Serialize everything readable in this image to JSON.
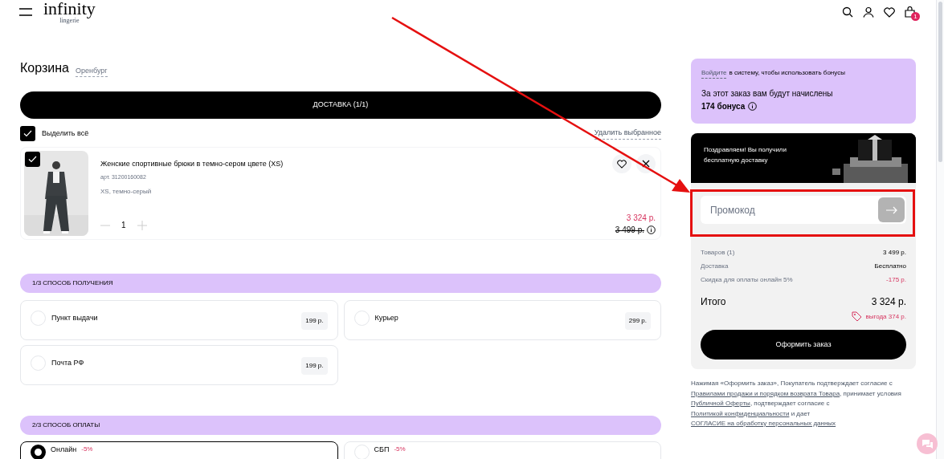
{
  "header": {
    "logo": "infinity",
    "logo_sub": "lingerie",
    "cart_count": "1"
  },
  "cart": {
    "title": "Корзина",
    "city": "Оренбург",
    "tab": "ДОСТАВКА (1/1)",
    "select_all": {
      "label": "Выделить всё",
      "checked": true
    },
    "delete_selected": "Удалить выбранное",
    "items": [
      {
        "checked": true,
        "name": "Женские спортивные брюки в темно-сером цвете (XS)",
        "sku": "арт. 31200160082",
        "variant": "XS, темно-серый",
        "qty": "1",
        "price": "3 324 р.",
        "old_price": "3 499 р."
      }
    ]
  },
  "delivery": {
    "title": "1/3 СПОСОБ ПОЛУЧЕНИЯ",
    "options": [
      {
        "label": "Пункт выдачи",
        "price": "199 р.",
        "selected": false
      },
      {
        "label": "Курьер",
        "price": "299 р.",
        "selected": false
      },
      {
        "label": "Почта РФ",
        "price": "199 р.",
        "selected": false
      }
    ]
  },
  "payment": {
    "title": "2/3 СПОСОБ ОПЛАТЫ",
    "options": [
      {
        "label": "Онлайн",
        "discount": "-5%",
        "selected": true
      },
      {
        "label": "СБП",
        "discount": "-5%",
        "selected": false
      }
    ]
  },
  "bonus": {
    "login_link": "Войдите",
    "login_rest": "в систему, чтобы использовать бонусы",
    "accrual": "За этот заказ вам будут начислены",
    "amount": "174 бонуса"
  },
  "promo_banner": {
    "text": "Поздравляем! Вы получили бесплатную доставку"
  },
  "promo": {
    "placeholder": "Промокод"
  },
  "summary": {
    "rows": [
      {
        "label": "Товаров (1)",
        "value": "3 499 р.",
        "kind": "normal"
      },
      {
        "label": "Доставка",
        "value": "Бесплатно",
        "kind": "normal"
      },
      {
        "label": "Скидка для оплаты онлайн 5%",
        "value": "-175 р.",
        "kind": "discount"
      }
    ],
    "total_label": "Итого",
    "total": "3 324 р.",
    "savings": "выгода 374 р.",
    "checkout": "Оформить заказ"
  },
  "legal": [
    {
      "text": "Нажимая «Оформить заказ», Покупатель подтверждает согласие с ",
      "kind": "text"
    },
    {
      "text": "Правилами продажи и порядком возврата Товара",
      "kind": "link"
    },
    {
      "text": ", принимает условия ",
      "kind": "text"
    },
    {
      "text": "Публичной Оферты",
      "kind": "link"
    },
    {
      "text": ", подтверждает согласие с ",
      "kind": "text"
    },
    {
      "text": "Политикой конфиденциальности",
      "kind": "link"
    },
    {
      "text": " и дает ",
      "kind": "text"
    },
    {
      "text": "СОГЛАСИЕ на обработку персональных данных",
      "kind": "link"
    }
  ]
}
